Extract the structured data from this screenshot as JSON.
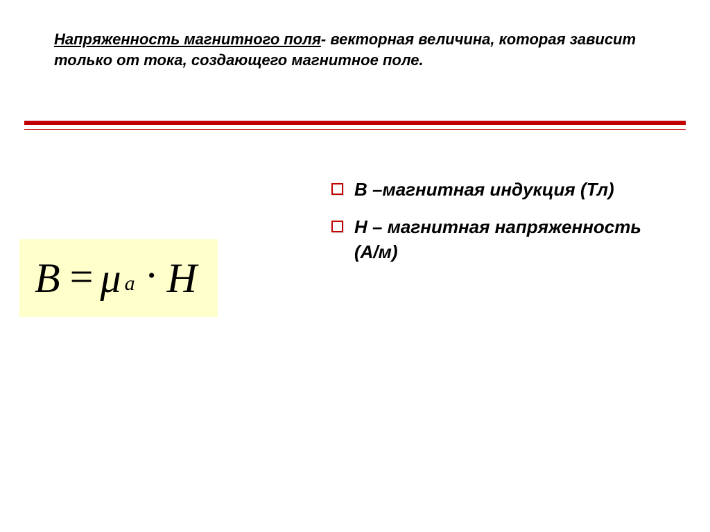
{
  "title": {
    "underlined": "Напряженность магнитного поля",
    "rest": "- векторная величина, которая зависит только от тока, создающего магнитное поле."
  },
  "formula": {
    "lhs": "B",
    "eq": "=",
    "mu": "μ",
    "sub": "a",
    "dot": "·",
    "rhs": "H"
  },
  "bullets": [
    {
      "text": "B –магнитная индукция (Тл)"
    },
    {
      "text": "H – магнитная напряженность (А/м)"
    }
  ]
}
